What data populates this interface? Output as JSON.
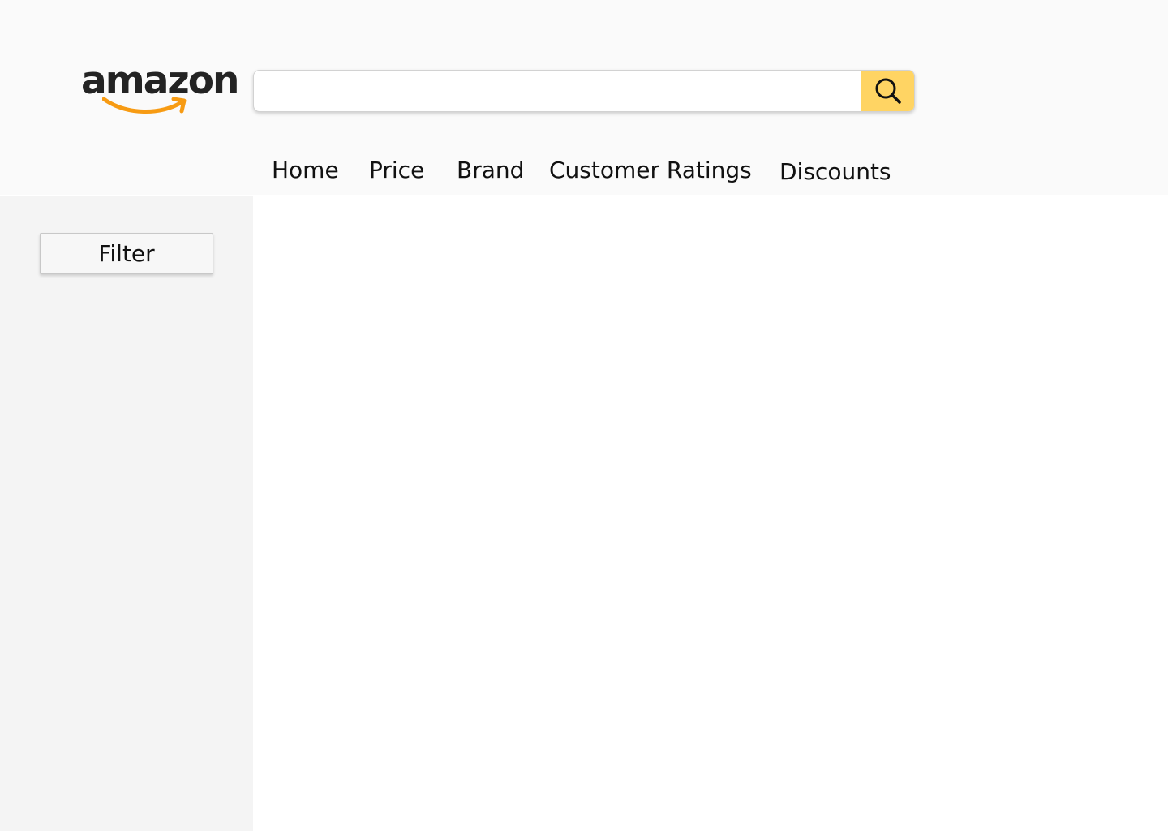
{
  "brand": {
    "logo_text": "amazon",
    "smile_color": "#f79b13",
    "text_color": "#232323"
  },
  "search": {
    "value": "",
    "placeholder": "",
    "button_icon": "search-icon",
    "button_color": "#ffd463"
  },
  "nav": {
    "items": [
      {
        "label": "Home"
      },
      {
        "label": "Price"
      },
      {
        "label": "Brand"
      },
      {
        "label": "Customer Ratings"
      },
      {
        "label": "Discounts"
      }
    ]
  },
  "sidebar": {
    "filter_label": "Filter"
  },
  "colors": {
    "header_bg": "#fafafa",
    "sidebar_bg": "#f4f4f4",
    "main_bg": "#ffffff"
  }
}
